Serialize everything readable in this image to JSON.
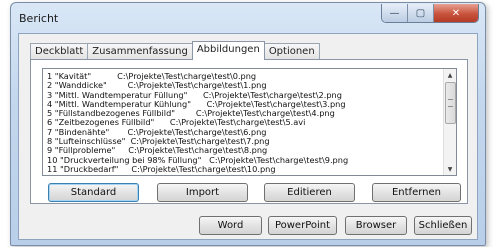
{
  "window": {
    "title": "Bericht",
    "controls": {
      "minimize": "—",
      "maximize": "▢",
      "close": "✕"
    }
  },
  "tabs": [
    {
      "label": "Deckblatt",
      "active": false
    },
    {
      "label": "Zusammenfassung",
      "active": false
    },
    {
      "label": "Abbildungen",
      "active": true
    },
    {
      "label": "Optionen",
      "active": false
    }
  ],
  "figures": [
    "1 \"Kavität\"          C:\\Projekte\\Test\\charge\\test\\0.png",
    "2 \"Wanddicke\"        C:\\Projekte\\Test\\charge\\test\\1.png",
    "3 \"Mittl. Wandtemperatur Füllung\"      C:\\Projekte\\Test\\charge\\test\\2.png",
    "4 \"Mittl. Wandtemperatur Kühlung\"      C:\\Projekte\\Test\\charge\\test\\3.png",
    "5 \"Füllstandbezogenes Füllbild\"        C:\\Projekte\\Test\\charge\\test\\4.png",
    "6 \"Zeitbezogenes Füllbild\"      C:\\Projekte\\Test\\charge\\test\\5.avi",
    "7 \"Bindenähte\"       C:\\Projekte\\Test\\charge\\test\\6.png",
    "8 \"Lufteinschlüsse\"  C:\\Projekte\\Test\\charge\\test\\7.png",
    "9 \"Füllprobleme\"     C:\\Projekte\\Test\\charge\\test\\8.png",
    "10 \"Druckverteilung bei 98% Füllung\"   C:\\Projekte\\Test\\charge\\test\\9.png",
    "11 \"Druckbedarf\"     C:\\Projekte\\Test\\charge\\test\\10.png"
  ],
  "panel_buttons": {
    "standard": "Standard",
    "import": "Import",
    "edit": "Editieren",
    "remove": "Entfernen"
  },
  "dialog_buttons": {
    "word": "Word",
    "powerpoint": "PowerPoint",
    "browser": "Browser",
    "close": "Schließen"
  },
  "scrollbar": {
    "up_arrow": "▲",
    "down_arrow": "▼"
  }
}
